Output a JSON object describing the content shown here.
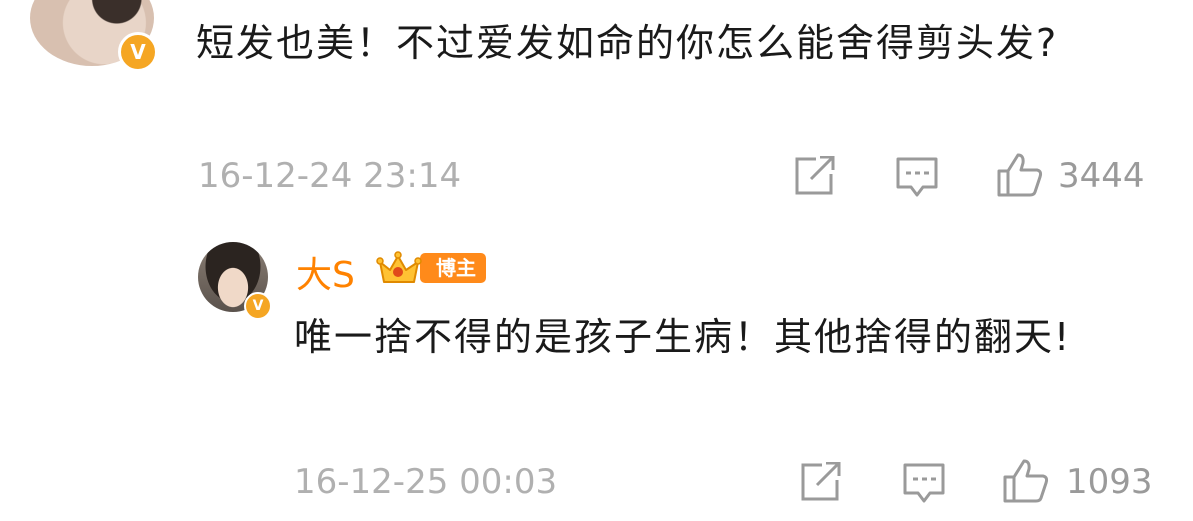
{
  "comment": {
    "text": "短发也美！不过爱发如命的你怎么能舍得剪头发?",
    "timestamp": "16-12-24 23:14",
    "like_count": "3444",
    "verified_badge": "V"
  },
  "reply": {
    "author": "大S",
    "author_badge": "博主",
    "text": "唯一捨不得的是孩子生病！其他捨得的翻天!",
    "timestamp": "16-12-25 00:03",
    "like_count": "1093",
    "verified_badge": "V"
  },
  "icons": {
    "share": "share-icon",
    "comment": "comment-icon",
    "like": "like-icon"
  },
  "colors": {
    "author": "#ff8200",
    "verified": "#f5a623",
    "meta": "#b0b0b0"
  }
}
